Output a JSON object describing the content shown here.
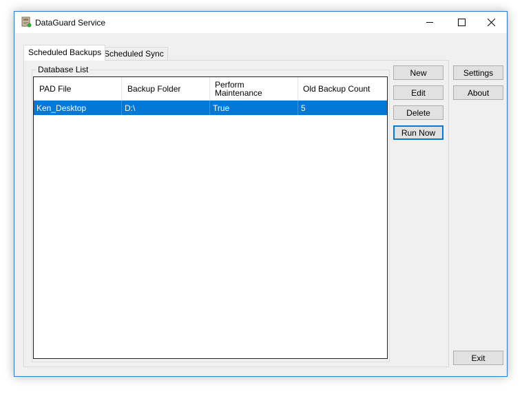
{
  "window": {
    "title": "DataGuard Service",
    "controls": {
      "minimize": "minimize",
      "maximize": "maximize",
      "close": "close"
    }
  },
  "tabs": [
    {
      "label": "Scheduled Backups",
      "active": true
    },
    {
      "label": "Scheduled Sync",
      "active": false
    }
  ],
  "database_list": {
    "group_label": "Database List",
    "columns": [
      "PAD File",
      "Backup Folder",
      "Perform\nMaintenance",
      "Old Backup Count"
    ],
    "rows": [
      {
        "cells": [
          "Ken_Desktop",
          "D:\\",
          "True",
          "5"
        ],
        "selected": true
      }
    ]
  },
  "actions": {
    "new_label": "New",
    "edit_label": "Edit",
    "delete_label": "Delete",
    "run_now_label": "Run Now"
  },
  "side": {
    "settings_label": "Settings",
    "about_label": "About",
    "exit_label": "Exit"
  },
  "colors": {
    "selection": "#0078d7",
    "window_border": "#2b79d8",
    "button_face": "#e1e1e1"
  }
}
